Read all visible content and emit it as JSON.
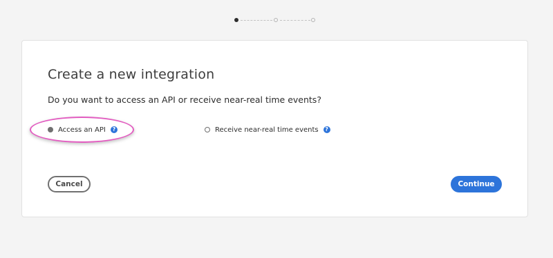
{
  "stepper": {
    "total_steps": 3,
    "current_step": 1
  },
  "dialog": {
    "title": "Create a new integration",
    "question": "Do you want to access an API or receive near-real time events?",
    "options": [
      {
        "label": "Access an API",
        "selected": true,
        "help_icon": "question-circle-icon"
      },
      {
        "label": "Receive near-real time events",
        "selected": false,
        "help_icon": "question-circle-icon"
      }
    ],
    "help_glyph": "?",
    "cancel_label": "Cancel",
    "continue_label": "Continue"
  },
  "colors": {
    "accent": "#2d74da",
    "highlight": "#e25cc0",
    "background": "#f4f4f4"
  }
}
